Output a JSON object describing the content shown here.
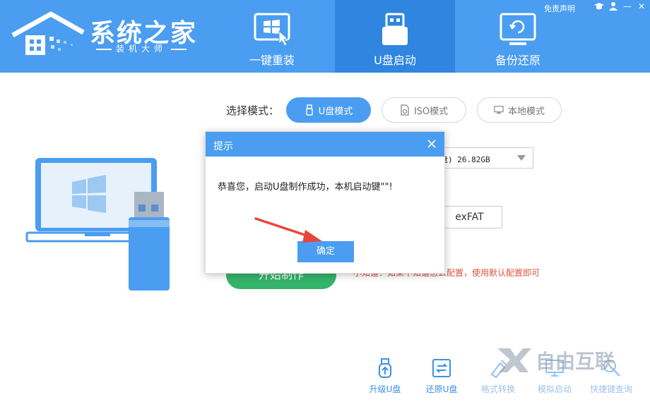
{
  "header": {
    "brand_title": "系统之家",
    "brand_subtitle": "装机大师",
    "top_link": "免责声明",
    "tabs": [
      {
        "label": "一键重装",
        "icon": "windows-cursor-icon"
      },
      {
        "label": "U盘启动",
        "icon": "usb-drive-icon"
      },
      {
        "label": "备份还原",
        "icon": "backup-restore-icon"
      }
    ],
    "active_tab": 1,
    "window_buttons": {
      "minimize": "—",
      "close": "✕"
    },
    "brand_color": "#4a9df0",
    "active_tab_color": "#2f85e0"
  },
  "mode": {
    "label": "选择模式：",
    "options": [
      {
        "label": "U盘模式",
        "icon": "usb-small-icon",
        "active": true
      },
      {
        "label": "ISO模式",
        "icon": "iso-file-icon",
        "active": false
      },
      {
        "label": "本地模式",
        "icon": "monitor-icon",
        "active": false
      }
    ]
  },
  "behind_dialog": {
    "device_value": "盘) 26.82GB",
    "filesystem": "exFAT",
    "start_button_label": "开始制作",
    "hint": "小知道：如果不知道怎么配置，使用默认配置即可"
  },
  "dialog": {
    "title": "提示",
    "message": "恭喜您，启动U盘制作成功，本机启动键\"\"!",
    "ok_label": "确定"
  },
  "tools": [
    {
      "label": "升级U盘",
      "icon": "usb-upgrade-icon"
    },
    {
      "label": "还原U盘",
      "icon": "restore-icon"
    },
    {
      "label": "格式转换",
      "icon": "format-convert-icon"
    },
    {
      "label": "模拟启动",
      "icon": "simulate-boot-icon"
    },
    {
      "label": "快捷键查询",
      "icon": "shortcut-search-icon"
    }
  ],
  "watermark": "自由互联",
  "colors": {
    "accent": "#4a9df0",
    "start_green": "#34b36b",
    "hint_red": "#e0533b",
    "arrow_red": "#e8443a"
  }
}
